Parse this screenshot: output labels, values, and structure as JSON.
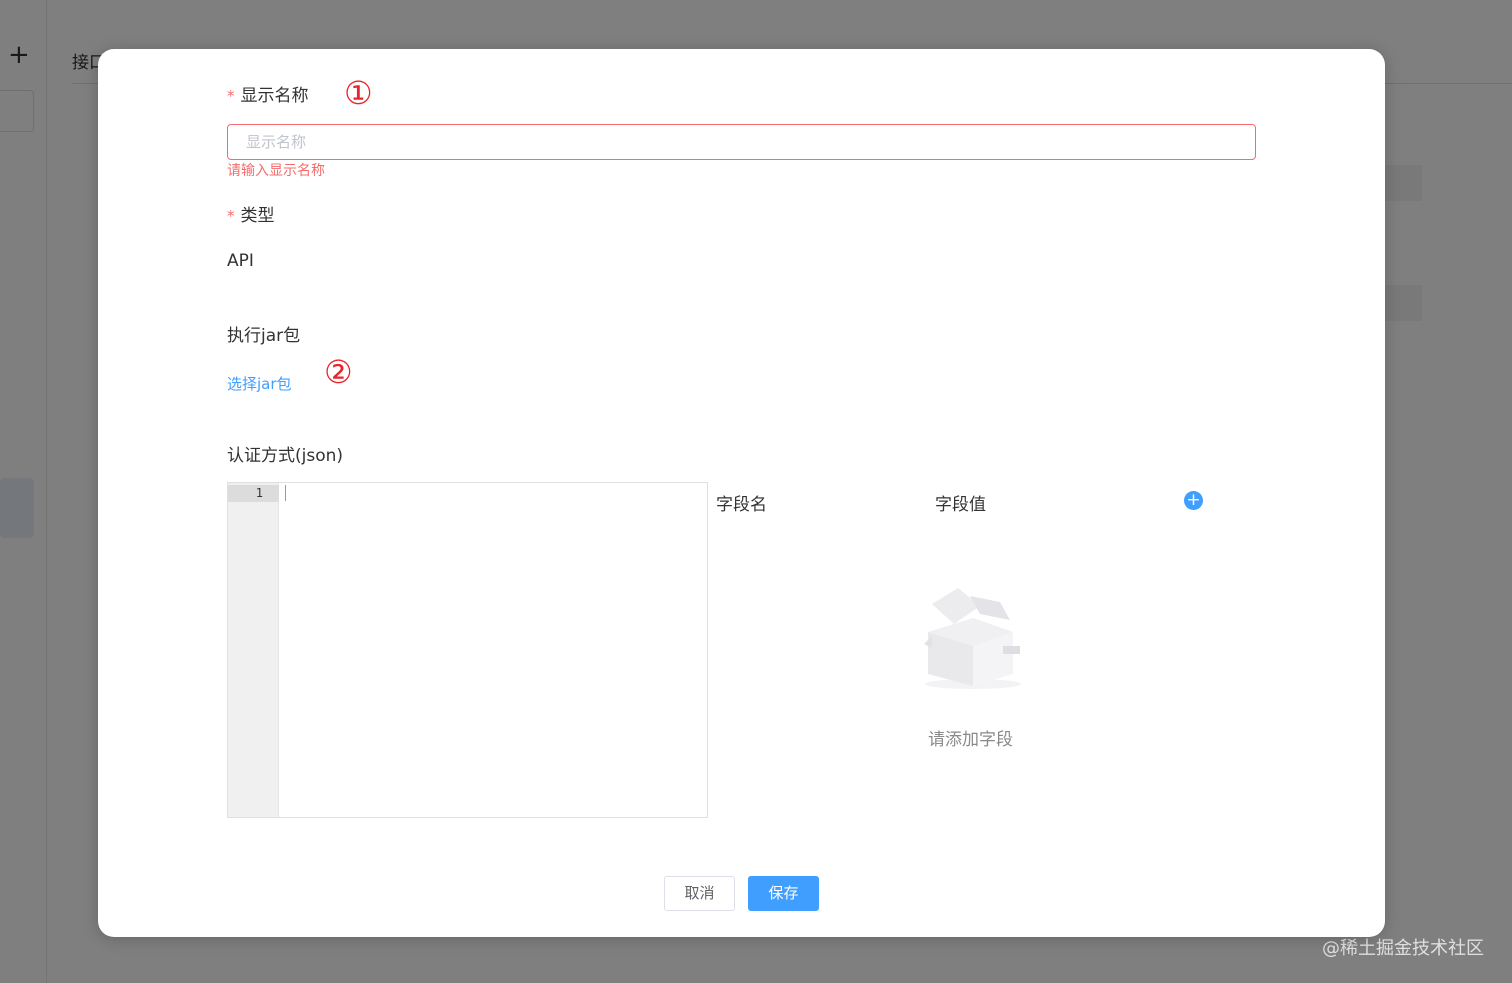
{
  "background": {
    "tab_label": "接口",
    "plus_glyph": "+",
    "watermark": "@稀土掘金技术社区"
  },
  "dialog": {
    "display_name": {
      "label": "显示名称",
      "required_mark": "*",
      "annotation": "①",
      "placeholder": "显示名称",
      "value": "",
      "error": "请输入显示名称"
    },
    "type": {
      "label": "类型",
      "required_mark": "*",
      "value": "API"
    },
    "jar": {
      "label": "执行jar包",
      "link": "选择jar包",
      "annotation": "②"
    },
    "auth": {
      "label": "认证方式(json)",
      "editor_line_numbers": [
        "1"
      ],
      "editor_content": ""
    },
    "fields": {
      "name_header": "字段名",
      "value_header": "字段值",
      "add_icon": "plus-circle-icon",
      "empty_text": "请添加字段"
    },
    "footer": {
      "cancel_label": "取消",
      "save_label": "保存"
    }
  },
  "colors": {
    "primary": "#409eff",
    "error": "#f56c6c",
    "annotation_red": "#e8252b",
    "overlay": "rgba(0,0,0,0.5)"
  }
}
